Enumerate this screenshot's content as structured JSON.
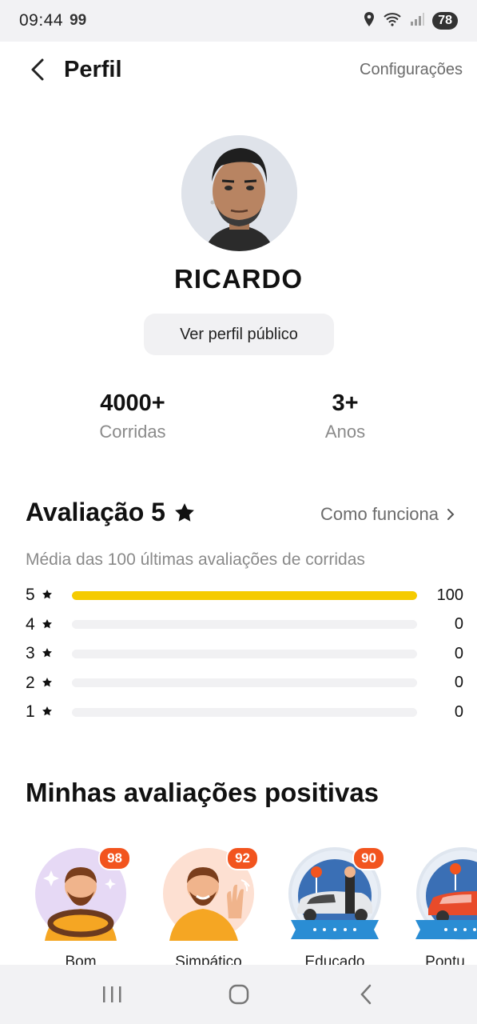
{
  "status": {
    "time": "09:44",
    "extra": "99",
    "battery": "78"
  },
  "header": {
    "title": "Perfil",
    "settings_label": "Configurações"
  },
  "profile": {
    "name": "RICARDO",
    "public_profile_label": "Ver perfil público"
  },
  "stats": [
    {
      "value": "4000+",
      "label": "Corridas"
    },
    {
      "value": "3+",
      "label": "Anos"
    }
  ],
  "rating": {
    "title": "Avaliação 5",
    "how_it_works": "Como funciona",
    "subtitle": "Média das 100 últimas avaliações de corridas",
    "distribution": [
      {
        "stars": "5",
        "count": "100",
        "fraction": 1.0
      },
      {
        "stars": "4",
        "count": "0",
        "fraction": 0
      },
      {
        "stars": "3",
        "count": "0",
        "fraction": 0
      },
      {
        "stars": "2",
        "count": "0",
        "fraction": 0
      },
      {
        "stars": "1",
        "count": "0",
        "fraction": 0
      }
    ],
    "bar_color": "#f5cb00"
  },
  "positive": {
    "title": "Minhas avaliações positivas",
    "badges": [
      {
        "count": "98",
        "label": "Bom",
        "icon": "steering-wheel-driver-icon"
      },
      {
        "count": "92",
        "label": "Simpático",
        "icon": "waving-driver-icon"
      },
      {
        "count": "90",
        "label": "Educado",
        "icon": "car-door-driver-icon"
      },
      {
        "count": "",
        "label": "Pontu",
        "icon": "red-car-icon"
      }
    ]
  },
  "colors": {
    "accent": "#f2541e",
    "star_bar": "#f5cb00"
  }
}
